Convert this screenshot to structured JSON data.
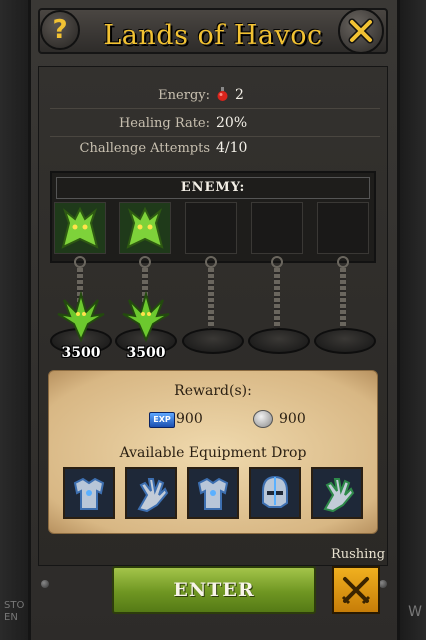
{
  "header": {
    "title": "Lands of Havoc",
    "help_label": "?"
  },
  "stats": {
    "energy_label": "Energy:",
    "energy_value": "2",
    "healing_label": "Healing Rate:",
    "healing_value": "20%",
    "attempts_label": "Challenge Attempts",
    "attempts_value": "4/10"
  },
  "enemy": {
    "heading": "Enemy:",
    "units": [
      {
        "hp": "3500",
        "icon": "green-dragon-icon"
      },
      {
        "hp": "3500",
        "icon": "green-dragon-icon"
      }
    ],
    "empty_slots": 3
  },
  "rewards": {
    "title": "Reward(s):",
    "exp_badge": "EXP",
    "exp_value": "900",
    "silver_value": "900",
    "equipment_title": "Available Equipment Drop",
    "equipment": [
      "armor-icon",
      "gauntlet-icon",
      "armor-icon",
      "helmet-icon",
      "gauntlet-icon"
    ]
  },
  "actions": {
    "enter_label": "Enter",
    "rushing_label": "Rushing"
  },
  "background": {
    "left_peek": "STO\nEN",
    "right_peek": "W"
  },
  "colors": {
    "title": "#f2c233",
    "enter_green": "#6f9622",
    "rush_orange": "#e39a12",
    "scroll": "#e8cf9e"
  }
}
